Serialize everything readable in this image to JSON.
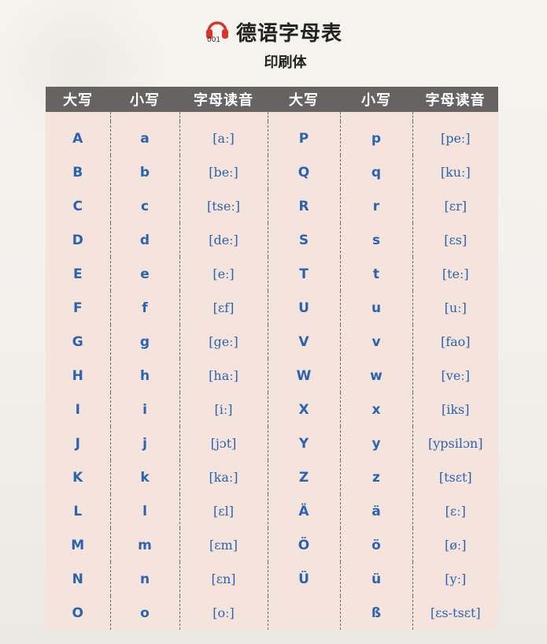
{
  "header": {
    "track_number": "001",
    "title": "德语字母表",
    "subtitle": "印刷体"
  },
  "table": {
    "columns": [
      "大写",
      "小写",
      "字母读音",
      "大写",
      "小写",
      "字母读音"
    ],
    "rows": [
      [
        "A",
        "a",
        "[aː]",
        "P",
        "p",
        "[peː]"
      ],
      [
        "B",
        "b",
        "[beː]",
        "Q",
        "q",
        "[kuː]"
      ],
      [
        "C",
        "c",
        "[tseː]",
        "R",
        "r",
        "[ɛr]"
      ],
      [
        "D",
        "d",
        "[deː]",
        "S",
        "s",
        "[ɛs]"
      ],
      [
        "E",
        "e",
        "[eː]",
        "T",
        "t",
        "[teː]"
      ],
      [
        "F",
        "f",
        "[ɛf]",
        "U",
        "u",
        "[uː]"
      ],
      [
        "G",
        "g",
        "[geː]",
        "V",
        "v",
        "[fao]"
      ],
      [
        "H",
        "h",
        "[haː]",
        "W",
        "w",
        "[veː]"
      ],
      [
        "I",
        "i",
        "[iː]",
        "X",
        "x",
        "[iks]"
      ],
      [
        "J",
        "j",
        "[jɔt]",
        "Y",
        "y",
        "[ypsilɔn]"
      ],
      [
        "K",
        "k",
        "[kaː]",
        "Z",
        "z",
        "[tsɛt]"
      ],
      [
        "L",
        "l",
        "[ɛl]",
        "Ä",
        "ä",
        "[ɛː]"
      ],
      [
        "M",
        "m",
        "[ɛm]",
        "Ö",
        "ö",
        "[øː]"
      ],
      [
        "N",
        "n",
        "[ɛn]",
        "Ü",
        "ü",
        "[yː]"
      ],
      [
        "O",
        "o",
        "[oː]",
        "",
        "ß",
        "[ɛs-tsɛt]"
      ]
    ]
  },
  "colors": {
    "header_bg": "#666462",
    "body_bg": "#f4e4dc",
    "letter_blue": "#2a63b2",
    "icon_red": "#d9342b"
  }
}
